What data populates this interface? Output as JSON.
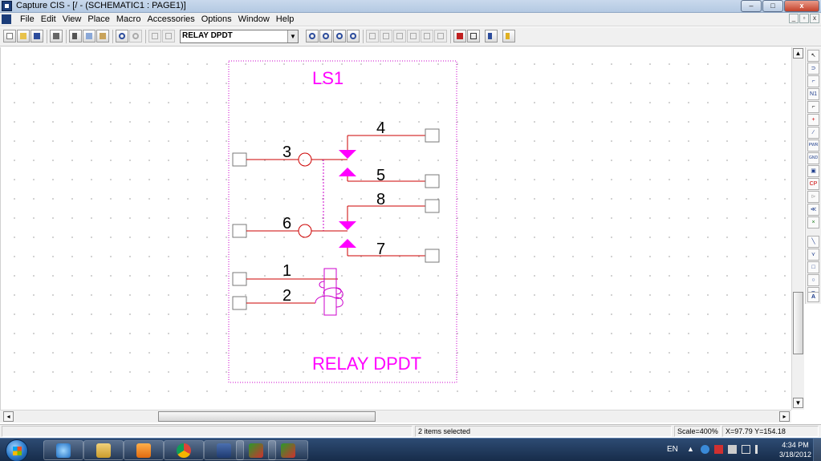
{
  "window": {
    "title": "Capture CIS - [/ - (SCHEMATIC1 : PAGE1)]",
    "controls": {
      "minimize": "–",
      "maximize": "□",
      "close": "x"
    },
    "mdi_controls": {
      "minimize": "_",
      "restore": "▫",
      "close": "x"
    }
  },
  "menu": {
    "items": [
      "File",
      "Edit",
      "View",
      "Place",
      "Macro",
      "Accessories",
      "Options",
      "Window",
      "Help"
    ]
  },
  "toolbar": {
    "part_combo_value": "RELAY DPDT",
    "combo_arrow": "▼",
    "buttons": [
      "new-icon",
      "open-icon",
      "save-icon",
      "print-icon",
      "cut-icon",
      "copy-icon",
      "paste-icon",
      "undo-icon",
      "redo-icon",
      "view-icon",
      "view-icon",
      "zoom-in-icon",
      "zoom-out-icon",
      "zoom-area-icon",
      "zoom-all-icon",
      "annotate-icon",
      "design-rules-icon",
      "cross-reference-icon",
      "netlist-icon",
      "bill-of-materials-icon",
      "snap-grid-icon",
      "project-manager-icon",
      "property-editor-icon",
      "help-icon"
    ]
  },
  "schematic": {
    "refdes": "LS1",
    "part_value": "RELAY DPDT",
    "pins": [
      "1",
      "2",
      "3",
      "4",
      "5",
      "6",
      "7",
      "8"
    ],
    "colors": {
      "pin_line": "#cc0000",
      "body": "#ff00ff",
      "outline": "#cc00cc",
      "pin_box": "#7a7a7a"
    }
  },
  "palette": {
    "tools": [
      {
        "icon": "select-icon",
        "glyph": "↖"
      },
      {
        "icon": "place-part-icon",
        "glyph": "⊃"
      },
      {
        "icon": "place-wire-icon",
        "glyph": "⌐"
      },
      {
        "icon": "place-net-alias-icon",
        "glyph": "N1"
      },
      {
        "icon": "place-bus-icon",
        "glyph": "⌐"
      },
      {
        "icon": "place-junction-icon",
        "glyph": "+"
      },
      {
        "icon": "place-bus-entry-icon",
        "glyph": "∕"
      },
      {
        "icon": "place-power-icon",
        "glyph": "PWR"
      },
      {
        "icon": "place-ground-icon",
        "glyph": "GND"
      },
      {
        "icon": "place-hierarchical-block-icon",
        "glyph": "▣"
      },
      {
        "icon": "place-hierarchical-port-icon",
        "glyph": "CP"
      },
      {
        "icon": "place-hierarchical-pin-icon",
        "glyph": "⊳"
      },
      {
        "icon": "place-off-page-connector-icon",
        "glyph": "≪"
      },
      {
        "icon": "place-no-connect-icon",
        "glyph": "×"
      },
      {
        "icon": "place-line-icon",
        "glyph": "╲"
      },
      {
        "icon": "place-polyline-icon",
        "glyph": "⋎"
      },
      {
        "icon": "place-rectangle-icon",
        "glyph": "□"
      },
      {
        "icon": "place-ellipse-icon",
        "glyph": "○"
      },
      {
        "icon": "place-arc-icon",
        "glyph": "⊃"
      },
      {
        "icon": "place-text-icon",
        "glyph": "A"
      }
    ]
  },
  "scrollbars": {
    "up": "▲",
    "down": "▼",
    "left": "◂",
    "right": "▸"
  },
  "status": {
    "cell_1": "",
    "selection": "2 items selected",
    "scale": "Scale=400%",
    "coords": "X=97.79  Y=154.18"
  },
  "taskbar": {
    "language": "EN",
    "tray_arrow": "▲",
    "time": "4:34 PM",
    "date": "3/18/2012",
    "apps": [
      "internet-explorer-icon",
      "windows-explorer-icon",
      "media-player-icon",
      "chrome-icon",
      "capture-cis-icon",
      "capture-cis-icon",
      "capture-cis-icon"
    ]
  }
}
